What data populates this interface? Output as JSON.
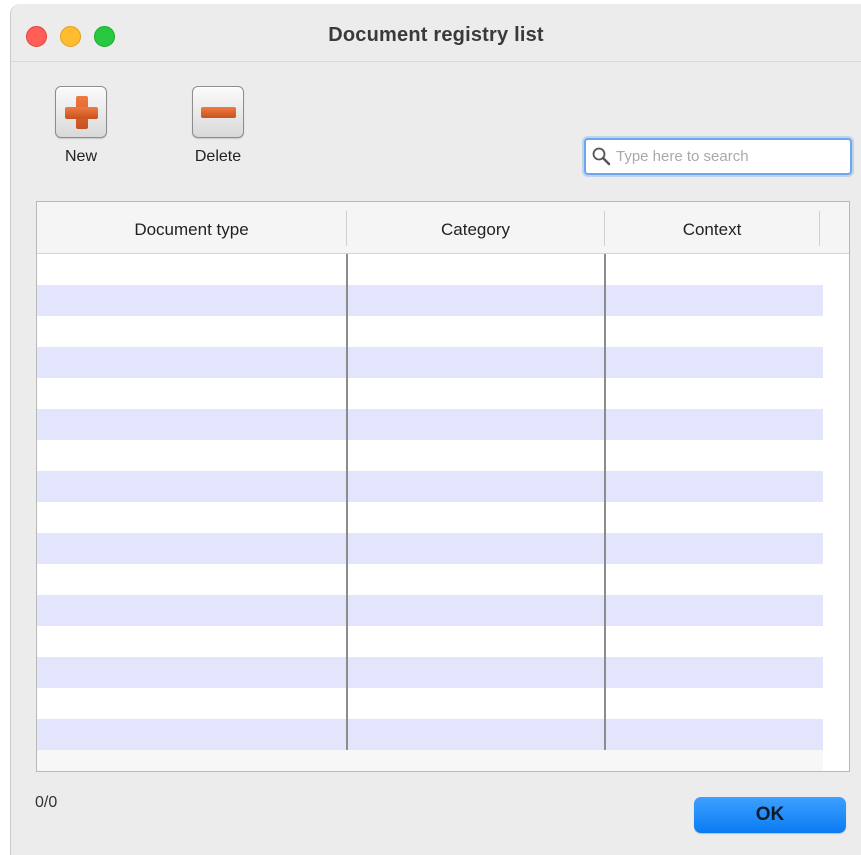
{
  "window": {
    "title": "Document registry list"
  },
  "toolbar": {
    "new_label": "New",
    "delete_label": "Delete"
  },
  "search": {
    "placeholder": "Type here to search",
    "value": ""
  },
  "table": {
    "columns": [
      "Document type",
      "Category",
      "Context"
    ],
    "rows": [],
    "row_stripe_color": "#e2e5fb"
  },
  "status": {
    "record_count": "0/0"
  },
  "dialog": {
    "ok_label": "OK"
  },
  "icons": {
    "close": "close-dot",
    "minimize": "minimize-dot",
    "maximize": "maximize-dot",
    "new": "plus-icon",
    "delete": "minus-icon",
    "search": "magnifier-icon"
  },
  "colors": {
    "accent": "#0a7bf3",
    "icon_orange": "#e0652e"
  }
}
